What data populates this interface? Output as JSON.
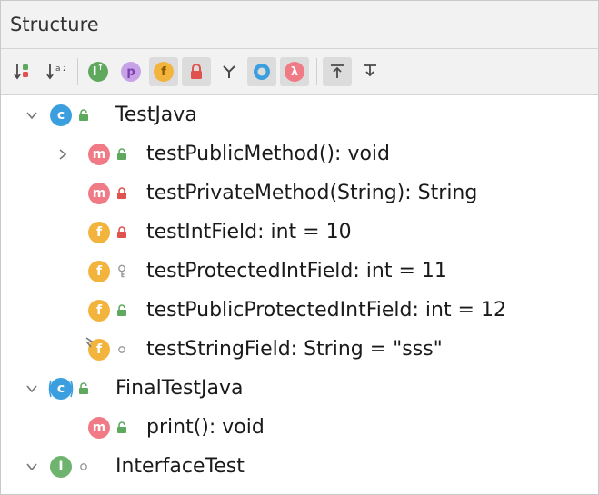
{
  "panel": {
    "title": "Structure"
  },
  "toolbar": {
    "buttons": [
      {
        "name": "sort-by-visibility-button",
        "icon": "sort-visibility-icon",
        "active": false
      },
      {
        "name": "sort-alphabetically-button",
        "icon": "sort-alpha-icon",
        "glyph": "a z",
        "active": false
      },
      {
        "name": "show-inherited-button",
        "icon": "inherited-icon",
        "glyph": "I",
        "active": false
      },
      {
        "name": "show-properties-button",
        "icon": "property-icon",
        "glyph": "p",
        "active": false
      },
      {
        "name": "show-fields-button",
        "icon": "field-icon",
        "glyph": "f",
        "active": true
      },
      {
        "name": "show-non-public-button",
        "icon": "lock-icon",
        "active": true
      },
      {
        "name": "show-anonymous-button",
        "icon": "anonymous-icon",
        "active": false
      },
      {
        "name": "show-lambdas-button",
        "icon": "circle-icon",
        "active": true
      },
      {
        "name": "show-lambda-button",
        "icon": "lambda-icon",
        "glyph": "λ",
        "active": true
      },
      {
        "name": "expand-all-button",
        "icon": "expand-icon",
        "active": true
      },
      {
        "name": "collapse-all-button",
        "icon": "collapse-icon",
        "active": false
      }
    ],
    "colors": {
      "green": "#5fa95f",
      "red": "#e0524d",
      "blue": "#3b9ede",
      "purple": "#b07fd6",
      "orange": "#f3b43e",
      "pink": "#f07a86"
    }
  },
  "tree": [
    {
      "label": "TestJava",
      "icon": "class",
      "glyph": "c",
      "visibility": "public",
      "indent": 0,
      "arrow": "expanded"
    },
    {
      "label": "testPublicMethod(): void",
      "icon": "method",
      "glyph": "m",
      "visibility": "public",
      "indent": 1,
      "arrow": "collapsed"
    },
    {
      "label": "testPrivateMethod(String): String",
      "icon": "method",
      "glyph": "m",
      "visibility": "private",
      "indent": 1,
      "arrow": "none"
    },
    {
      "label": "testIntField: int = 10",
      "icon": "field",
      "glyph": "f",
      "visibility": "private",
      "indent": 1,
      "arrow": "none"
    },
    {
      "label": "testProtectedIntField: int = 11",
      "icon": "field",
      "glyph": "f",
      "visibility": "protected",
      "indent": 1,
      "arrow": "none"
    },
    {
      "label": "testPublicProtectedIntField: int = 12",
      "icon": "field",
      "glyph": "f",
      "visibility": "public",
      "indent": 1,
      "arrow": "none"
    },
    {
      "label": "testStringField: String = \"sss\"",
      "icon": "static-field",
      "glyph": "f",
      "visibility": "package",
      "indent": 1,
      "arrow": "none"
    },
    {
      "label": "FinalTestJava",
      "icon": "final-class",
      "glyph": "c",
      "visibility": "public",
      "indent": 0,
      "arrow": "expanded"
    },
    {
      "label": "print(): void",
      "icon": "method",
      "glyph": "m",
      "visibility": "public",
      "indent": 1,
      "arrow": "none"
    },
    {
      "label": "InterfaceTest",
      "icon": "interface",
      "glyph": "I",
      "visibility": "package",
      "indent": 0,
      "arrow": "expanded"
    }
  ]
}
